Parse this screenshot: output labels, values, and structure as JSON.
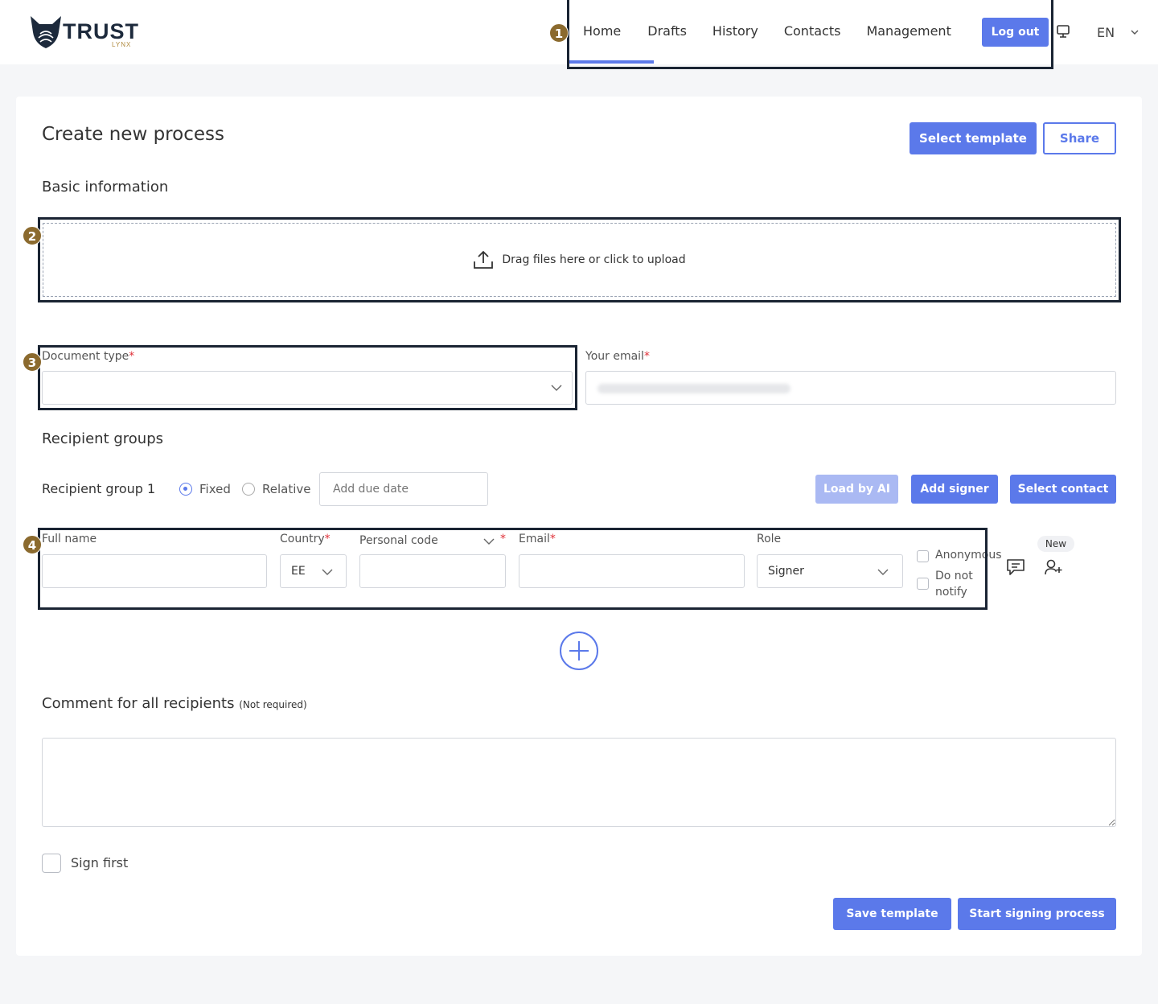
{
  "header": {
    "logo_text": "TRUST",
    "logo_sub": "LYNX",
    "nav": [
      "Home",
      "Drafts",
      "History",
      "Contacts",
      "Management"
    ],
    "logout_label": "Log out",
    "language": "EN"
  },
  "annotations": [
    "1",
    "2",
    "3",
    "4"
  ],
  "page": {
    "title": "Create new process",
    "select_template_label": "Select template",
    "share_label": "Share"
  },
  "basic": {
    "heading": "Basic information",
    "upload_text": "Drag files here or click to upload",
    "document_type_label": "Document type",
    "document_type_value": "",
    "email_label": "Your email",
    "required_mark": "*"
  },
  "recipients": {
    "heading": "Recipient groups",
    "group_label": "Recipient group 1",
    "fixed_label": "Fixed",
    "relative_label": "Relative",
    "due_date_placeholder": "Add due date",
    "load_ai_label": "Load by AI",
    "add_signer_label": "Add signer",
    "select_contact_label": "Select contact",
    "full_name_label": "Full name",
    "country_label": "Country",
    "country_value": "EE",
    "personal_code_label": "Personal code",
    "email_label": "Email",
    "role_label": "Role",
    "role_value": "Signer",
    "anonymous_label": "Anonymous",
    "do_not_notify_label": "Do not notify",
    "new_badge": "New"
  },
  "comment": {
    "heading": "Comment for all recipients",
    "note": "(Not required)"
  },
  "footer": {
    "sign_first_label": "Sign first",
    "save_template_label": "Save template",
    "start_label": "Start signing process"
  },
  "colors": {
    "accent": "#5b79ea",
    "disabled": "#aab9f3",
    "annotation": "#1a2433",
    "badge": "#8b6a2e",
    "required": "#e0323a"
  }
}
